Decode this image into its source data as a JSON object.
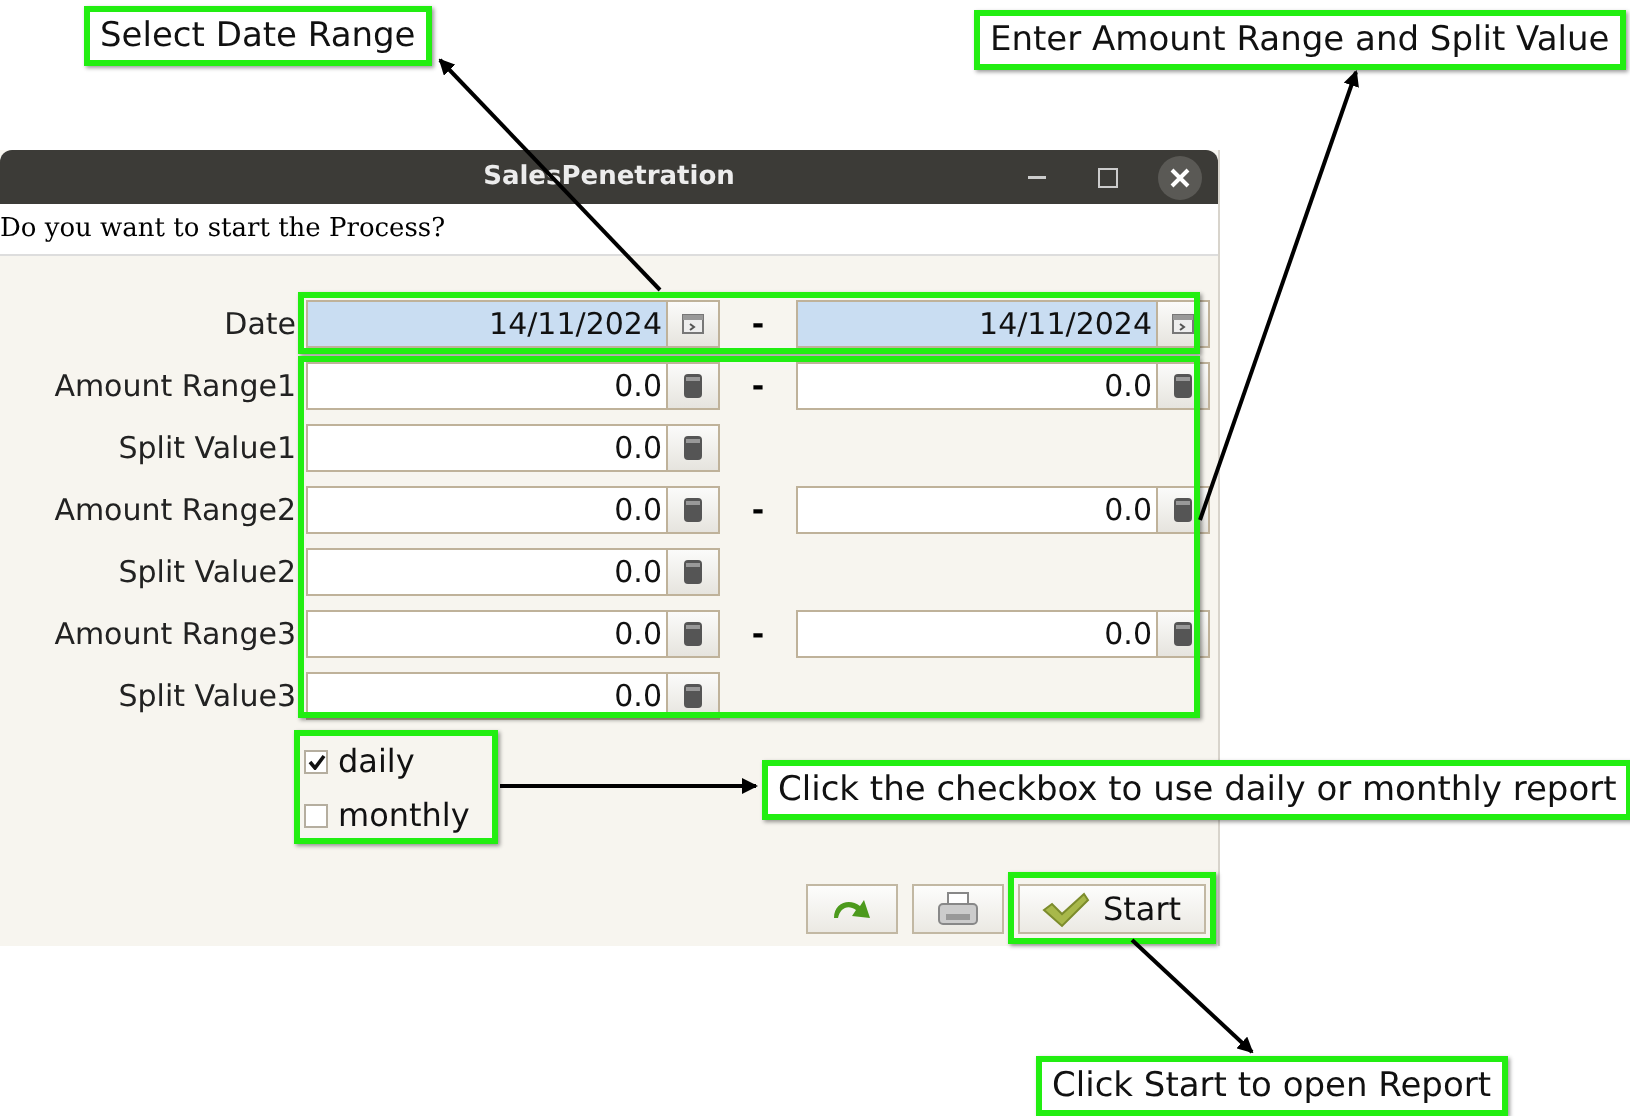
{
  "window": {
    "title": "SalesPenetration",
    "question": "Do you want to start the Process?"
  },
  "date_row": {
    "label": "Date",
    "from": "14/11/2024",
    "separator": "-",
    "to": "14/11/2024"
  },
  "rows": [
    {
      "kind": "range",
      "label": "Amount Range1",
      "from": "0.0",
      "separator": "-",
      "to": "0.0"
    },
    {
      "kind": "split",
      "label": "Split Value1",
      "value": "0.0"
    },
    {
      "kind": "range",
      "label": "Amount Range2",
      "from": "0.0",
      "separator": "-",
      "to": "0.0"
    },
    {
      "kind": "split",
      "label": "Split Value2",
      "value": "0.0"
    },
    {
      "kind": "range",
      "label": "Amount Range3",
      "from": "0.0",
      "separator": "-",
      "to": "0.0"
    },
    {
      "kind": "split",
      "label": "Split Value3",
      "value": "0.0"
    }
  ],
  "options": [
    {
      "label": "daily",
      "checked": true
    },
    {
      "label": "monthly",
      "checked": false
    }
  ],
  "buttons": [
    {
      "kind": "refresh"
    },
    {
      "kind": "print"
    },
    {
      "kind": "start",
      "label": "Start"
    }
  ],
  "callouts": [
    {
      "text": "Select Date Range"
    },
    {
      "text": "Enter Amount Range and Split Value"
    },
    {
      "text": "Click the checkbox to use daily or monthly report"
    },
    {
      "text": "Click Start to open Report"
    }
  ]
}
